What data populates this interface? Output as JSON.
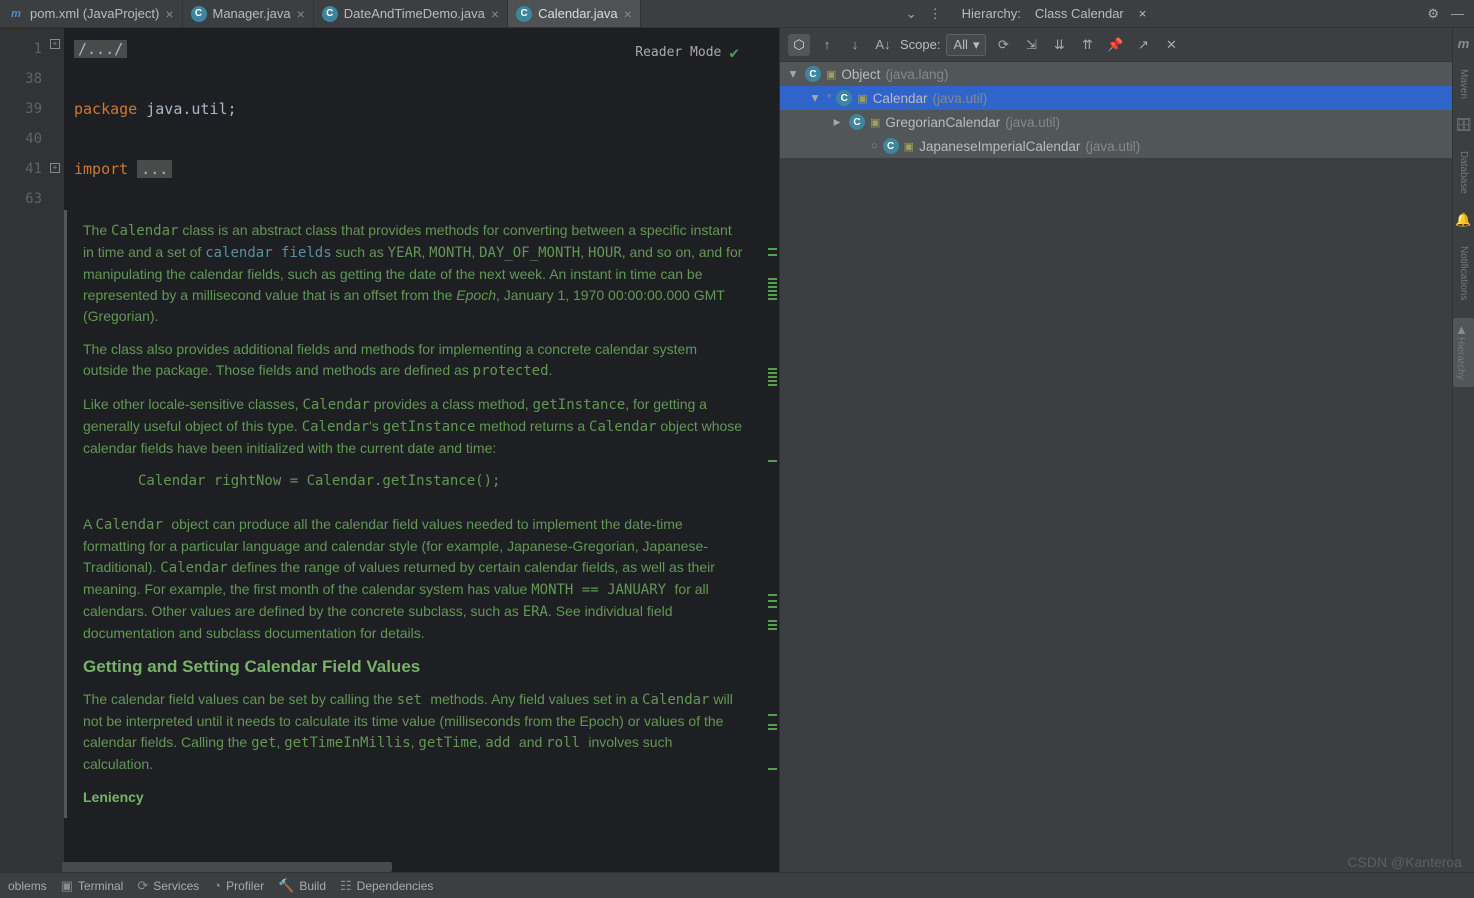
{
  "tabs": [
    {
      "icon": "m",
      "label": "pom.xml (JavaProject)"
    },
    {
      "icon": "c",
      "label": "Manager.java"
    },
    {
      "icon": "c",
      "label": "DateAndTimeDemo.java"
    },
    {
      "icon": "c",
      "label": "Calendar.java"
    }
  ],
  "hierarchy": {
    "panelTitle": "Hierarchy:",
    "itemLabel": "Class Calendar"
  },
  "readerMode": "Reader Mode",
  "gutter": [
    "1",
    "38",
    "39",
    "40",
    "41",
    "63"
  ],
  "code": {
    "foldComment": "/.../",
    "packageKw": "package ",
    "packageStmt": "java.util;",
    "importKw": "import ",
    "importFold": "..."
  },
  "doc": {
    "p1a": "The ",
    "p1_cal": "Calendar",
    "p1b": " class is an abstract class that provides methods for converting between a specific instant in time and a set of ",
    "p1_cf": "calendar fields",
    "p1c": " such as ",
    "p1_yr": "YEAR",
    "p1d": ", ",
    "p1_mo": "MONTH",
    "p1e": ", ",
    "p1_dom": "DAY_OF_MONTH",
    "p1f": ", ",
    "p1_hr": "HOUR",
    "p1g": ", and so on, and for manipulating the calendar fields, such as getting the date of the next week. An instant in time can be represented by a millisecond value that is an offset from the ",
    "p1_ep": "Epoch",
    "p1h": ", January 1, 1970 00:00:00.000 GMT (Gregorian).",
    "p2a": "The class also provides additional fields and methods for implementing a concrete calendar system outside the package. Those fields and methods are defined as ",
    "p2_prot": "protected",
    "p2b": ".",
    "p3a": "Like other locale-sensitive classes, ",
    "p3_cal": "Calendar",
    "p3b": " provides a class method, ",
    "p3_gi": "getInstance",
    "p3c": ", for getting a generally useful object of this type. ",
    "p3_cal2": "Calendar",
    "p3d": "'s ",
    "p3_gi2": "getInstance",
    "p3e": " method returns a ",
    "p3_cal3": "Calendar",
    "p3f": " object whose calendar fields have been initialized with the current date and time:",
    "codeLine": "Calendar rightNow = Calendar.getInstance();",
    "p4a": "A ",
    "p4_cal": " Calendar ",
    "p4b": "object can produce all the calendar field values needed to implement the date-time formatting for a particular language and calendar style (for example, Japanese-Gregorian, Japanese-Traditional). ",
    "p4_cal2": "Calendar",
    "p4c": " defines the range of values returned by certain calendar fields, as well as their meaning. For example, the first month of the calendar system has value ",
    "p4_mj": " MONTH == JANUARY ",
    "p4d": "for all calendars. Other values are defined by the concrete subclass, such as ",
    "p4_era": " ERA",
    "p4e": ". See individual field documentation and subclass documentation for details.",
    "h3": "Getting and Setting Calendar Field Values",
    "p5a": "The calendar field values can be set by calling the ",
    "p5_set": " set ",
    "p5b": "methods. Any field values set in a ",
    "p5_cal": "Calendar",
    "p5c": " will not be interpreted until it needs to calculate its time value (milliseconds from the Epoch) or values of the calendar fields. Calling the ",
    "p5_get": "get",
    "p5d": ", ",
    "p5_gtim": " getTimeInMillis",
    "p5e": ", ",
    "p5_gtime": " getTime",
    "p5f": ", ",
    "p5_add": "add ",
    "p5g": "and ",
    "p5_roll": " roll ",
    "p5h": "involves such calculation.",
    "h4": "Leniency"
  },
  "toolbar": {
    "scopeLabel": "Scope:",
    "scopeValue": "All"
  },
  "tree": [
    {
      "indent": 0,
      "chev": "▾",
      "icon": "C",
      "name": "Object",
      "pkg": "(java.lang)",
      "bg": "row-bg"
    },
    {
      "indent": 1,
      "chev": "▾",
      "abstr": "*",
      "icon": "C",
      "iconcls": "icon-i",
      "name": "Calendar",
      "pkg": "(java.util)",
      "bg": "row-sel"
    },
    {
      "indent": 2,
      "chev": "▸",
      "icon": "C",
      "name": "GregorianCalendar",
      "pkg": "(java.util)",
      "bg": "row-bg"
    },
    {
      "indent": 3,
      "chev": "",
      "dot": "○",
      "icon": "C",
      "name": "JapaneseImperialCalendar",
      "pkg": "(java.util)",
      "bg": "row-bg"
    }
  ],
  "rail": {
    "maven": "Maven",
    "db": "Database",
    "notif": "Notifications",
    "hier": "Hierarchy"
  },
  "bottom": {
    "problems": "oblems",
    "terminal": "Terminal",
    "services": "Services",
    "profiler": "Profiler",
    "build": "Build",
    "deps": "Dependencies"
  },
  "watermark": "CSDN @Kanteroa"
}
